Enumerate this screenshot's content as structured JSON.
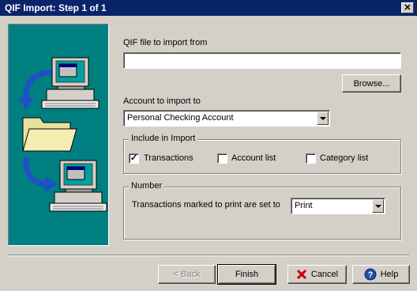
{
  "window": {
    "title": "QIF Import: Step 1 of 1",
    "close_glyph": "✕"
  },
  "form": {
    "file_label": "QIF file to import from",
    "file_value": "",
    "browse_label": "Browse...",
    "account_label": "Account to import to",
    "account_selected": "Personal Checking Account"
  },
  "include": {
    "title": "Include in Import",
    "options": [
      {
        "label": "Transactions",
        "checked": true
      },
      {
        "label": "Account list",
        "checked": false
      },
      {
        "label": "Category list",
        "checked": false
      }
    ]
  },
  "number": {
    "title": "Number",
    "label": "Transactions marked to print are set to",
    "selected": "Print"
  },
  "buttons": {
    "back": "< Back",
    "finish": "Finish",
    "cancel": "Cancel",
    "help": "Help"
  },
  "icons": {
    "cancel": "red-x-icon",
    "help": "question-mark-icon"
  },
  "colors": {
    "titlebar": "#0a246a",
    "art_bg": "#008080",
    "face": "#d4d0c8",
    "cancel_x": "#cc0000",
    "help_blue": "#1f4fa8"
  }
}
